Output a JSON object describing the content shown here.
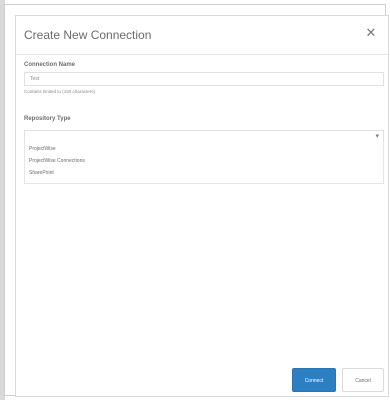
{
  "dialog": {
    "title": "Create New Connection",
    "close_icon": "close-icon"
  },
  "form": {
    "connection_name_label": "Connection Name",
    "connection_name_value": "Test",
    "connection_name_hint": "Contains limited to (150 characters)",
    "repository_type_label": "Repository Type",
    "repository_type_value": "",
    "repository_options": [
      "ProjectWise",
      "ProjectWise Connections",
      "SharePoint"
    ]
  },
  "buttons": {
    "connect_label": "Connect",
    "cancel_label": "Cancel"
  }
}
